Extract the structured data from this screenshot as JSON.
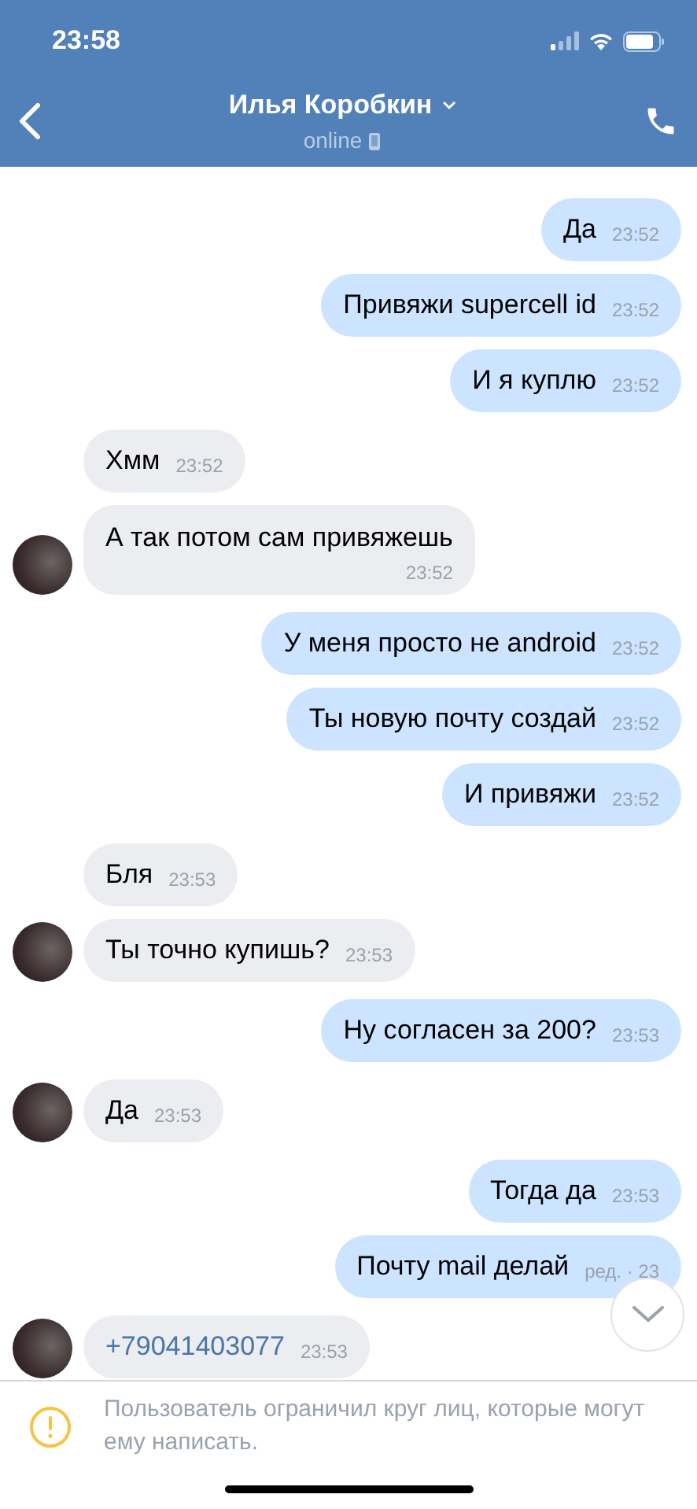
{
  "status_bar": {
    "time": "23:58"
  },
  "header": {
    "title": "Илья Коробкин",
    "status": "online"
  },
  "messages": [
    {
      "kind": "out",
      "text": "Да",
      "time": "23:52"
    },
    {
      "kind": "out",
      "text": "Привяжи supercell id",
      "time": "23:52"
    },
    {
      "kind": "out",
      "text": "И я куплю",
      "time": "23:52"
    },
    {
      "kind": "in",
      "text": "Хмм",
      "time": "23:52",
      "avatar": false
    },
    {
      "kind": "in",
      "text": "А так потом сам привяжешь",
      "time": "23:52",
      "avatar": true,
      "wrap": true
    },
    {
      "kind": "out",
      "text": "У меня просто не android",
      "time": "23:52"
    },
    {
      "kind": "out",
      "text": "Ты новую почту создай",
      "time": "23:52"
    },
    {
      "kind": "out",
      "text": "И привяжи",
      "time": "23:52"
    },
    {
      "kind": "in",
      "text": "Бля",
      "time": "23:53",
      "avatar": false
    },
    {
      "kind": "in",
      "text": "Ты точно купишь?",
      "time": "23:53",
      "avatar": true
    },
    {
      "kind": "out",
      "text": "Ну согласен за 200?",
      "time": "23:53"
    },
    {
      "kind": "in",
      "text": "Да",
      "time": "23:53",
      "avatar": true
    },
    {
      "kind": "out",
      "text": "Тогда да",
      "time": "23:53"
    },
    {
      "kind": "out",
      "text": "Почту mail делай",
      "time": "ред. · 23"
    },
    {
      "kind": "phone",
      "text": "+79041403077",
      "time": "23:53",
      "avatar": true
    }
  ],
  "notice": {
    "text": "Пользователь ограничил круг лиц, которые могут ему написать."
  }
}
